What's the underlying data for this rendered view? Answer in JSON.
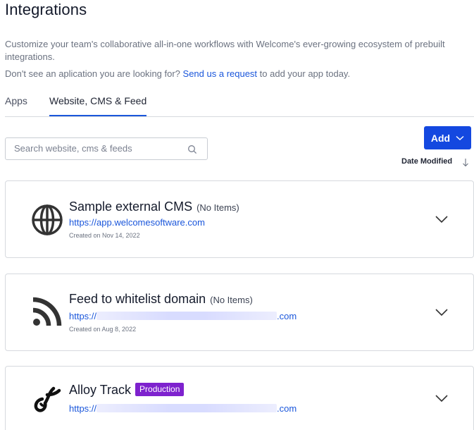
{
  "page": {
    "title": "Integrations",
    "description": "Customize your team's collaborative all-in-one workflows with Welcome's ever-growing ecosystem of prebuilt integrations.",
    "request_prefix": "Don't see an aplication you are looking for? ",
    "request_link": "Send us a request",
    "request_suffix": " to add your app today."
  },
  "tabs": [
    {
      "label": "Apps",
      "active": false
    },
    {
      "label": "Website, CMS & Feed",
      "active": true
    }
  ],
  "search": {
    "placeholder": "Search website, cms & feeds",
    "value": ""
  },
  "add_button": {
    "label": "Add"
  },
  "sort": {
    "label": "Date Modified",
    "direction": "descending"
  },
  "cards": [
    {
      "icon": "globe-icon",
      "name": "Sample external CMS",
      "items": "(No Items)",
      "url": "https://app.welcomesoftware.com",
      "created": "Created on Nov 14, 2022"
    },
    {
      "icon": "rss-feed-icon",
      "name": "Feed to whitelist domain",
      "items": "(No Items)",
      "url_prefix": "https://",
      "url_suffix": ".com",
      "created": "Created on Aug 8, 2022"
    },
    {
      "icon": "alloy-logo-icon",
      "name": "Alloy Track",
      "badge": "Production",
      "url_prefix": "https://",
      "url_suffix": ".com"
    }
  ],
  "colors": {
    "accent": "#1448e0",
    "link": "#1a56db",
    "badge": "#7e22ce"
  }
}
